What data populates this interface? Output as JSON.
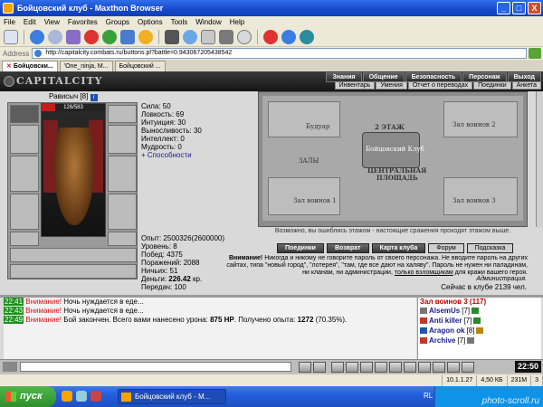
{
  "window": {
    "title": "Бойцовский клуб - Maxthon Browser",
    "controls": [
      "_",
      "□",
      "X"
    ]
  },
  "menu": [
    "File",
    "Edit",
    "View",
    "Favorites",
    "Groups",
    "Options",
    "Tools",
    "Window",
    "Help"
  ],
  "address": {
    "label": "Address",
    "url": "http://capitalcity.combats.ru/buttons.pl?battle=0.943067205438542"
  },
  "tabs": [
    {
      "label": "Бойцовски...",
      "active": true
    },
    {
      "label": "'One_ninja, M...",
      "active": false
    },
    {
      "label": "Бойцовский ...",
      "active": false
    }
  ],
  "game": {
    "logo": "CAPITALCITY",
    "topnav": [
      "Знания",
      "Общение",
      "Безопасность",
      "Персонаж",
      "Выход"
    ],
    "subnav": [
      "Инвентарь",
      "Умения",
      "Отчет о переводах",
      "Поединки",
      "Анкета"
    ],
    "character": {
      "name": "Рависыч",
      "level": "[8]",
      "badge": "i",
      "hp_text": "126/583",
      "hp_fraction": 0.216
    },
    "stats": [
      "Сила: 50",
      "Ловкость: 69",
      "Интуиция: 30",
      "Выносливость: 30",
      "Интеллект: 0",
      "Мудрость: 0"
    ],
    "abilities_label": "+ Способности",
    "stats2": [
      "Опыт: 2500326(2600000)",
      "Уровень: 8",
      "Побед: 4375",
      "Поражений: 2088",
      "Ничьих: 51"
    ],
    "money_label": "Деньги: ",
    "money_value": "226.42",
    "money_unit": " кр.",
    "transfers": "Передач: 100",
    "map": {
      "labels": {
        "boudoir": "Будуар",
        "floor2": "2 ЭТАЖ",
        "hall_knight1": "Зал воинов 2",
        "halls": "ЗАЛЫ",
        "club": "Бойцовский Клуб",
        "central": "ЦЕНТРАЛЬНАЯ",
        "square": "ПЛОЩАДЬ",
        "hall_knight2": "Зал воинов 1",
        "hall_knight3": "Зал воинов 3"
      },
      "caption": "Возможно, вы ошиблись этажом - настоящие сражения проходят этажом выше."
    },
    "actions": [
      "Поединки",
      "Возврат",
      "Карта клуба",
      "Форум",
      "Подсказка"
    ],
    "warning": {
      "bold": "Внимание!",
      "text": " Никогда и никому не говорите пароль от своего персонажа. Не вводите пароль на других сайтах, типа \"новый город\", \"лотерея\", \"там, где все дают на халяву\". Пароль не нужен ни паладинам, ни кланам, ни администрации, ",
      "underlined": "только взломщикам",
      "tail": " для кражи вашего героя."
    },
    "admin": "Администрация.",
    "online": "Сейчас в клубе 2139 чел."
  },
  "chat": {
    "lines": [
      {
        "time": "22:41",
        "warn": "Внимание!",
        "text": " Ночь нуждается в еде..."
      },
      {
        "time": "22:43",
        "warn": "Внимание!",
        "text": " Ночь нуждается в еде..."
      },
      {
        "time": "22:49",
        "warn": "Внимание!",
        "text": " Бой закончен. Всего вами нанесено урона: ",
        "dmg": "875 HP",
        "mid": ". Получено опыта: ",
        "exp": "1272",
        "tail": " (70.35%)."
      }
    ]
  },
  "room": {
    "title": "Зал воинов 3 (117)",
    "players": [
      {
        "name": "AlsemUs",
        "level": "[7]"
      },
      {
        "name": "Anti killer",
        "level": "[7]"
      },
      {
        "name": "Aragon ok",
        "level": "[8]"
      },
      {
        "name": "Archive",
        "level": "[7]"
      }
    ]
  },
  "clock": "22:50",
  "status": {
    "done": "",
    "ip": "10.1.1.27",
    "speed": "4,50 КБ",
    "mem": "231M",
    "count": "3"
  },
  "taskbar": {
    "start": "пуск",
    "task": "Бойцовский клуб - М...",
    "lang": "RL",
    "watermark": "photo-scroll.ru"
  },
  "colors": {
    "xp_blue": "#245edb",
    "chat_time": "#1a8f1a",
    "chat_warn": "#dd1111",
    "room_title": "#bb0000"
  }
}
